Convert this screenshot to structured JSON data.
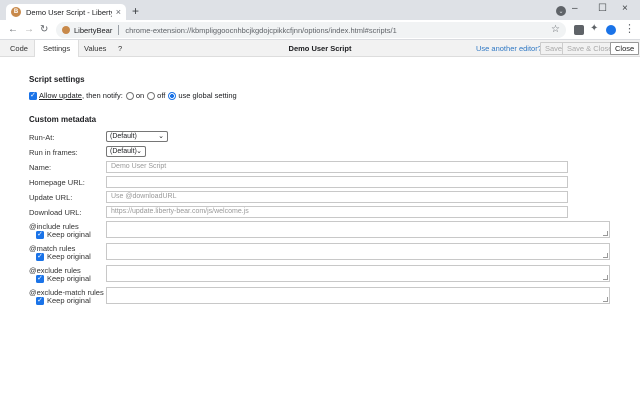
{
  "browser": {
    "tab_title": "Demo User Script - LibertyBear",
    "tab_close": "×",
    "new_tab": "+",
    "window_controls": [
      "–",
      "☐",
      "×"
    ],
    "nav": {
      "back": "←",
      "forward": "→",
      "reload": "↻"
    },
    "origin_label": "LibertyBear",
    "url": "chrome-extension://kbmpliggoocnhbcjkgdojcpikkcfjnn/options/index.html#scripts/1",
    "star": "☆",
    "menu": "⋮"
  },
  "editor": {
    "tabs": [
      {
        "label": "Code",
        "active": false
      },
      {
        "label": "Settings",
        "active": true
      },
      {
        "label": "Values",
        "active": false
      },
      {
        "label": "?",
        "active": false
      }
    ],
    "title": "Demo User Script",
    "other_editor_link": "Use another editor?",
    "buttons": {
      "save": "Save",
      "save_close": "Save & Close",
      "close": "Close"
    }
  },
  "script_settings": {
    "heading": "Script settings",
    "allow_update_label": "Allow update",
    "notify_text": ", then notify:",
    "options": [
      {
        "label": "on",
        "checked": false
      },
      {
        "label": "off",
        "checked": false
      },
      {
        "label": "use global setting",
        "checked": true
      }
    ]
  },
  "custom_metadata": {
    "heading": "Custom metadata",
    "run_at": {
      "label": "Run-At:",
      "value": "(Default)"
    },
    "run_in_frames": {
      "label": "Run in frames:",
      "value": "(Default)"
    },
    "name": {
      "label": "Name:",
      "placeholder": "Demo User Script"
    },
    "homepage": {
      "label": "Homepage URL:",
      "placeholder": ""
    },
    "update": {
      "label": "Update URL:",
      "placeholder": "Use @downloadURL"
    },
    "download": {
      "label": "Download URL:",
      "placeholder": "https://update.liberty-bear.com/js/welcome.js"
    },
    "rules": [
      {
        "label": "@include rules",
        "keep": "Keep original"
      },
      {
        "label": "@match rules",
        "keep": "Keep original"
      },
      {
        "label": "@exclude rules",
        "keep": "Keep original"
      },
      {
        "label": "@exclude-match rules",
        "keep": "Keep original"
      }
    ]
  },
  "colors": {
    "accent": "#1a73e8",
    "link": "#2f78c4",
    "brand": "#c8894a"
  }
}
